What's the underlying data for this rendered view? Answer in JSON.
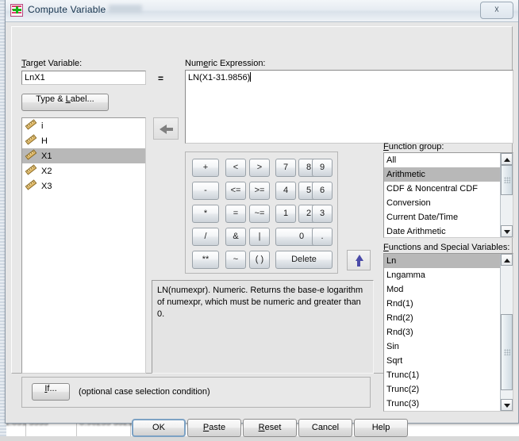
{
  "window": {
    "title": "Compute Variable",
    "app_icon": "spss-compute-icon",
    "close_label": "☓"
  },
  "target": {
    "label": "Target Variable:",
    "value": "LnX1",
    "equals": "=",
    "type_label_button": "Type & Label..."
  },
  "variables": {
    "items": [
      {
        "name": "i",
        "icon": "scale-ruler-icon",
        "selected": false
      },
      {
        "name": "H",
        "icon": "scale-ruler-icon",
        "selected": false
      },
      {
        "name": "X1",
        "icon": "scale-ruler-icon",
        "selected": true
      },
      {
        "name": "X2",
        "icon": "scale-ruler-icon",
        "selected": false
      },
      {
        "name": "X3",
        "icon": "scale-ruler-icon",
        "selected": false
      }
    ]
  },
  "move_button": {
    "icon": "arrow-right-into-expression-icon"
  },
  "expression": {
    "label": "Numeric Expression:",
    "value": "LN(X1-31.9856)",
    "caret_visible": true
  },
  "keypad": {
    "rows": [
      [
        "+",
        "<",
        ">",
        "7",
        "8",
        "9"
      ],
      [
        "-",
        "<=",
        ">=",
        "4",
        "5",
        "6"
      ],
      [
        "*",
        "=",
        "~=",
        "1",
        "2",
        "3"
      ],
      [
        "/",
        "&",
        "|",
        "0",
        "."
      ],
      [
        "**",
        "~",
        "( )",
        "Delete"
      ]
    ],
    "delete_label": "Delete"
  },
  "insert_function_button": {
    "icon": "arrow-up-insert-icon"
  },
  "function_help": {
    "text": "LN(numexpr). Numeric. Returns the base-e logarithm of numexpr, which must be numeric and greater than 0."
  },
  "function_group": {
    "label": "Function group:",
    "items": [
      {
        "name": "All",
        "selected": false
      },
      {
        "name": "Arithmetic",
        "selected": true
      },
      {
        "name": "CDF & Noncentral CDF",
        "selected": false
      },
      {
        "name": "Conversion",
        "selected": false
      },
      {
        "name": "Current Date/Time",
        "selected": false
      },
      {
        "name": "Date Arithmetic",
        "selected": false
      }
    ]
  },
  "functions": {
    "label": "Functions and Special Variables:",
    "items": [
      {
        "name": "Ln",
        "selected": true
      },
      {
        "name": "Lngamma",
        "selected": false
      },
      {
        "name": "Mod",
        "selected": false
      },
      {
        "name": "Rnd(1)",
        "selected": false
      },
      {
        "name": "Rnd(2)",
        "selected": false
      },
      {
        "name": "Rnd(3)",
        "selected": false
      },
      {
        "name": "Sin",
        "selected": false
      },
      {
        "name": "Sqrt",
        "selected": false
      },
      {
        "name": "Trunc(1)",
        "selected": false
      },
      {
        "name": "Trunc(2)",
        "selected": false
      },
      {
        "name": "Trunc(3)",
        "selected": false
      }
    ]
  },
  "condition": {
    "if_button": "If...",
    "note": "(optional case selection condition)"
  },
  "actions": [
    {
      "label": "OK",
      "default": true
    },
    {
      "label": "Paste",
      "default": false
    },
    {
      "label": "Reset",
      "default": false
    },
    {
      "label": "Cancel",
      "default": false
    },
    {
      "label": "Help",
      "default": false
    }
  ],
  "background": {
    "row_values": [
      "1.031 3333",
      "0.96233 3321"
    ]
  },
  "colors": {
    "dialog_face": "#e6e6e6",
    "selection": "#b8b8b8",
    "title_text": "#14324c",
    "default_button_border": "#7da2c4",
    "icon_green": "#19b219",
    "icon_pink": "#e4396f",
    "arrow_blue": "#4a4aa8"
  }
}
